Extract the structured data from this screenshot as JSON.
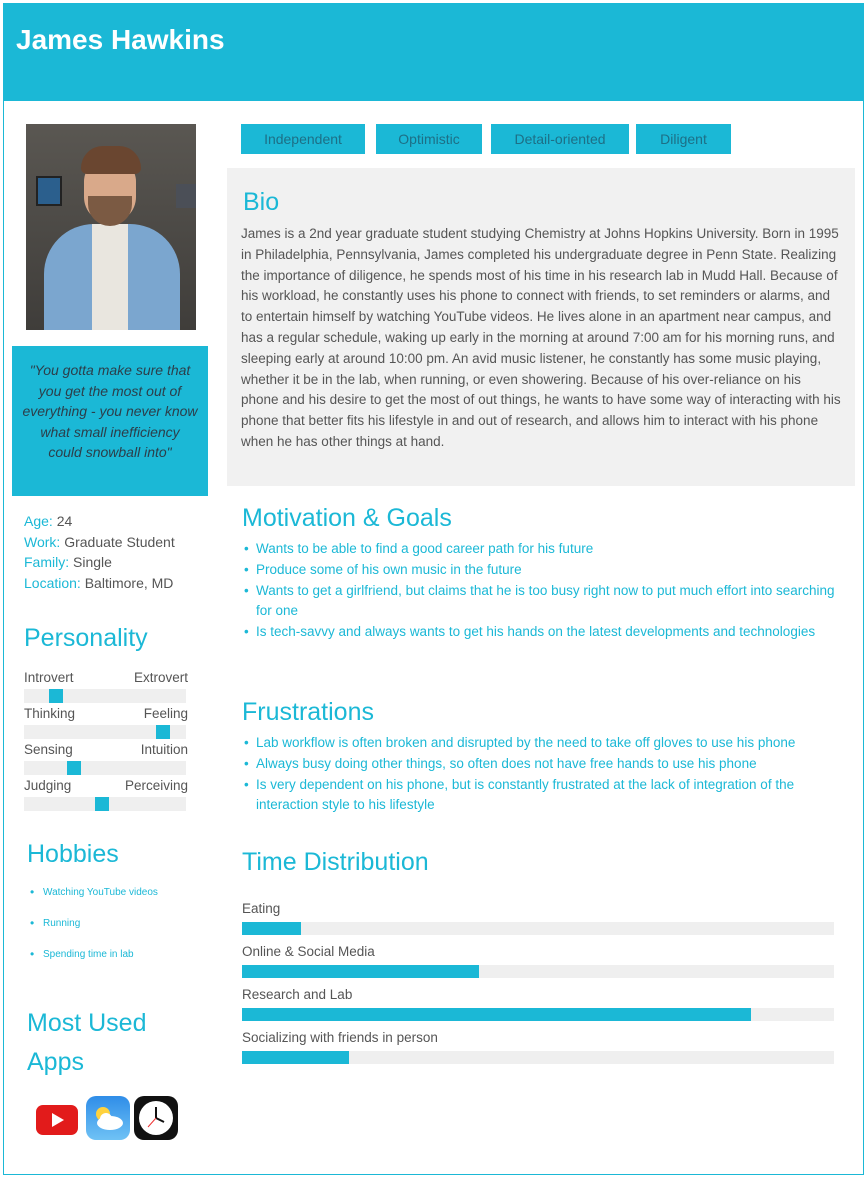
{
  "name": "James Hawkins",
  "quote": "\"You gotta make sure that you get the most out of everything - you never know what small inefficiency could snowball into\"",
  "info": [
    {
      "key": "Age:",
      "value": "24"
    },
    {
      "key": "Work:",
      "value": "Graduate Student"
    },
    {
      "key": "Family:",
      "value": "Single"
    },
    {
      "key": "Location:",
      "value": "Baltimore, MD"
    }
  ],
  "personality": {
    "title": "Personality",
    "sliders": [
      {
        "left": "Introvert",
        "right": "Extrovert",
        "level": 0.2
      },
      {
        "left": "Thinking",
        "right": "Feeling",
        "level": 0.86
      },
      {
        "left": "Sensing",
        "right": "Intuition",
        "level": 0.31
      },
      {
        "left": "Judging",
        "right": "Perceiving",
        "level": 0.48
      }
    ]
  },
  "tags": [
    "Independent",
    "Optimistic",
    "Detail-oriented",
    "Diligent"
  ],
  "bio": {
    "title": "Bio",
    "text": "James is a 2nd year graduate student studying Chemistry at Johns Hopkins University. Born in 1995 in Philadelphia, Pennsylvania, James completed his undergraduate degree in Penn State. Realizing the importance of diligence, he spends most of his time in his research lab in Mudd Hall. Because of his workload, he constantly uses his phone to connect with friends, to set reminders or alarms, and to entertain himself by watching YouTube videos. He lives alone in an apartment near campus, and has a regular schedule, waking up early in the morning at around 7:00 am for his morning runs, and sleeping early at around 10:00 pm. An avid music listener, he constantly has some music playing, whether it be in the lab, when running, or even showering. Because of his over-reliance on his phone and his desire to get the most of out things, he wants to have some way of interacting with his phone that better fits his lifestyle in and out of research, and allows him to interact with his phone when he has other things at hand."
  },
  "goals": {
    "title": "Motivation & Goals",
    "items": [
      "Wants to be able to find a good career path for his future",
      "Produce some of his own music in the future",
      "Wants to get a girlfriend, but claims that he is too busy right now to put much effort into searching for one",
      "Is tech-savvy and always wants to get his hands on the latest developments and technologies"
    ]
  },
  "frustrations": {
    "title": "Frustrations",
    "items": [
      "Lab workflow is often broken and disrupted by the need to take off gloves to use his phone",
      "Always busy doing other things, so often does not have free hands to use his phone",
      "Is very dependent on his phone, but is constantly frustrated at the lack of integration of the interaction style to his lifestyle"
    ]
  },
  "hobbies": {
    "title": "Hobbies",
    "items": [
      "Watching YouTube videos",
      "Running",
      "Spending time in lab"
    ]
  },
  "apps": {
    "title": "Most Used Apps",
    "icons": [
      "youtube-icon",
      "weather-icon",
      "clock-icon"
    ]
  },
  "time_distribution": {
    "title": "Time Distribution",
    "rows": [
      {
        "label": "Eating",
        "fraction": 0.1
      },
      {
        "label": "Online & Social Media",
        "fraction": 0.4
      },
      {
        "label": "Research and Lab",
        "fraction": 0.86
      },
      {
        "label": "Socializing with friends in person",
        "fraction": 0.18
      }
    ]
  },
  "colors": {
    "accent": "#1bb8d6",
    "panel": "#f1f1f1",
    "track": "#efefef"
  }
}
